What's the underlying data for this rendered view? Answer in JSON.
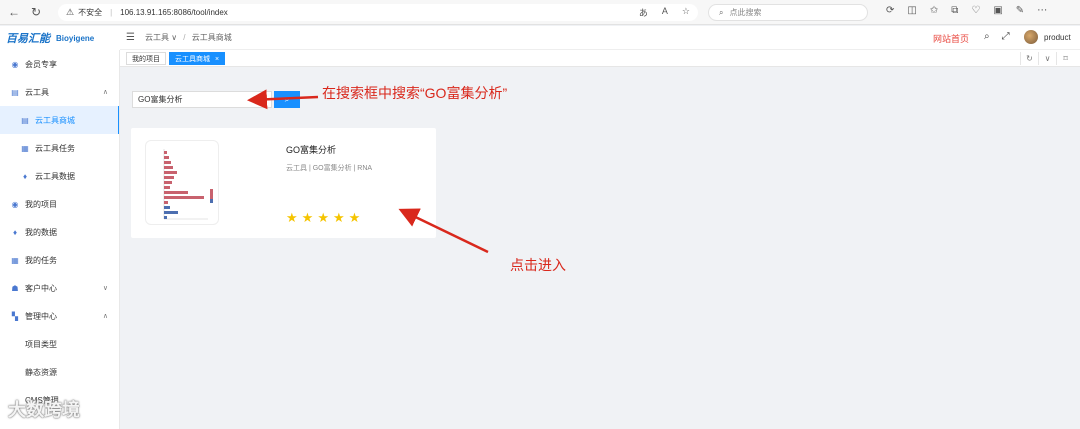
{
  "browser": {
    "security_label": "不安全",
    "url": "106.13.91.165:8086/tool/index",
    "search_placeholder": "点此搜索"
  },
  "logo": {
    "brand": "百易汇能",
    "brand_en": "Bioyigene"
  },
  "header": {
    "breadcrumb_root": "云工具",
    "breadcrumb_current": "云工具商城",
    "home_link": "网站首页",
    "username": "product"
  },
  "tabs": [
    {
      "label": "我的项目"
    },
    {
      "label": "云工具商城"
    }
  ],
  "sidebar": {
    "items": [
      {
        "label": "会员专享"
      },
      {
        "label": "云工具"
      },
      {
        "label": "云工具商城"
      },
      {
        "label": "云工具任务"
      },
      {
        "label": "云工具数据"
      },
      {
        "label": "我的项目"
      },
      {
        "label": "我的数据"
      },
      {
        "label": "我的任务"
      },
      {
        "label": "客户中心"
      },
      {
        "label": "管理中心"
      },
      {
        "label": "项目类型"
      },
      {
        "label": "静态资源"
      },
      {
        "label": "CMS管理"
      }
    ]
  },
  "search": {
    "value": "GO富集分析"
  },
  "annotations": {
    "search_hint": "在搜索框中搜索“GO富集分析”",
    "click_hint": "点击进入"
  },
  "tool_card": {
    "title": "GO富集分析",
    "tags": "云工具 | GO富集分析 | RNA",
    "rating": 5
  },
  "colors": {
    "accent": "#1890ff",
    "annotation": "#d9281c",
    "star": "#f5c400"
  },
  "watermark": "大数跨境"
}
